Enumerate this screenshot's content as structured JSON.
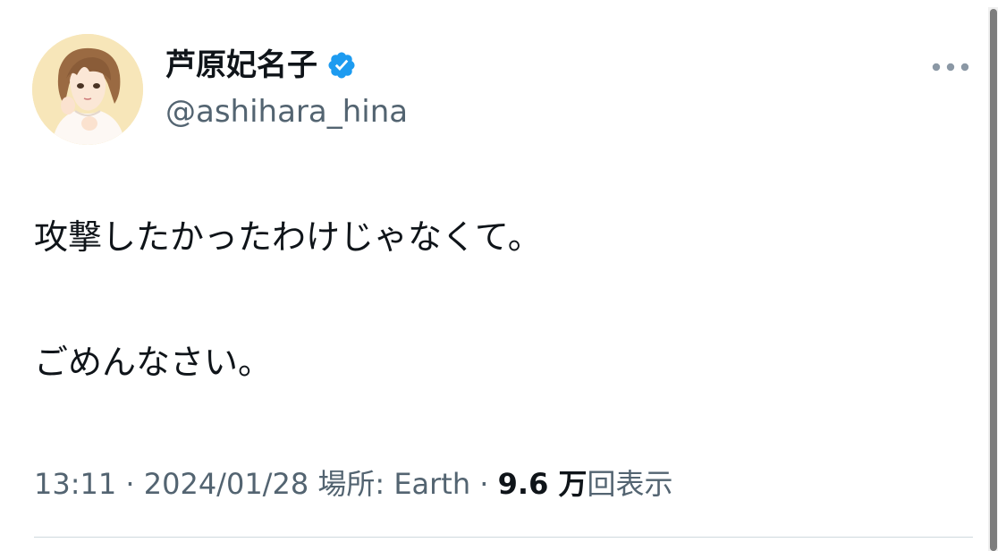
{
  "tweet": {
    "author": {
      "display_name": "芦原妃名子",
      "handle": "@ashihara_hina",
      "verified": true,
      "verified_color": "#1d9bf0",
      "avatar_icon": "illustrated-portrait-avatar"
    },
    "more_icon": "more-horizontal-icon",
    "text_lines": [
      "攻撃したかったわけじゃなくて。",
      "ごめんなさい。"
    ],
    "meta": {
      "time": "13:11",
      "separator": " · ",
      "date": "2024/01/28",
      "location_label": "場所: ",
      "location": "Earth",
      "views_count": "9.6 万",
      "views_label": "回表示"
    }
  },
  "colors": {
    "text_primary": "#0f1419",
    "text_secondary": "#536471",
    "divider": "#cfd9de",
    "scrollbar_thumb": "#7d7d7d"
  }
}
